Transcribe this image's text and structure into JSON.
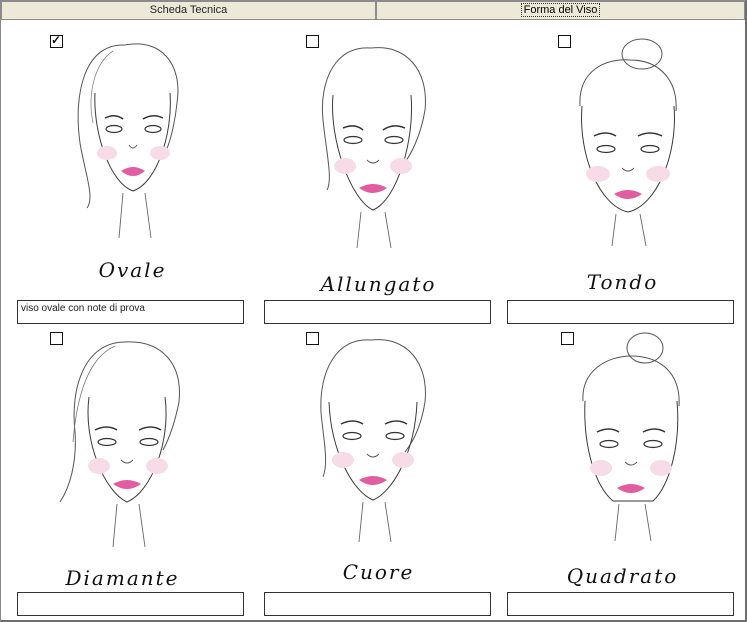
{
  "tabs": [
    {
      "label": "Scheda Tecnica",
      "active": false
    },
    {
      "label": "Forma del Viso",
      "active": true
    }
  ],
  "shapes": [
    {
      "label": "Ovale",
      "checked": true,
      "note": "viso ovale con note di prova",
      "hair": "side-long"
    },
    {
      "label": "Allungato",
      "checked": false,
      "note": "",
      "hair": "side-long"
    },
    {
      "label": "Tondo",
      "checked": false,
      "note": "",
      "hair": "top-bun"
    },
    {
      "label": "Diamante",
      "checked": false,
      "note": "",
      "hair": "side-long"
    },
    {
      "label": "Cuore",
      "checked": false,
      "note": "",
      "hair": "side-long"
    },
    {
      "label": "Quadrato",
      "checked": false,
      "note": "",
      "hair": "top-bun"
    }
  ],
  "colors": {
    "lips": "#e25ca0",
    "blush": "#f7dbe6",
    "line": "#3a3a3a"
  },
  "icons": {
    "check": "check-icon"
  }
}
